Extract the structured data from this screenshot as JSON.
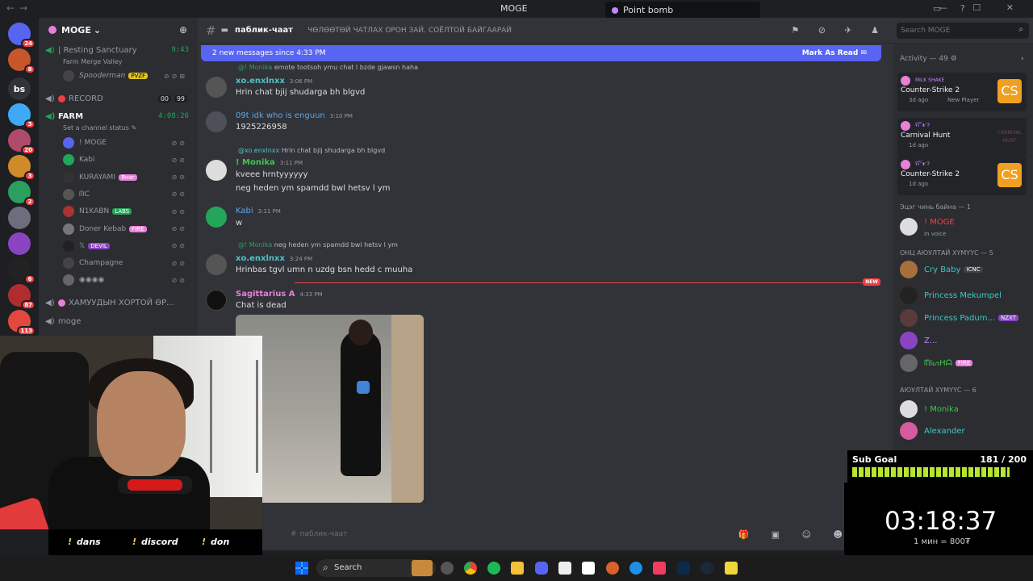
{
  "window": {
    "title": "MOGE",
    "overlay_title": "Point bomb"
  },
  "server": {
    "name": "MOGE",
    "add_member_icon": "add-member-icon"
  },
  "rail": {
    "servers": [
      {
        "label": "",
        "color": "#5865f2",
        "badge": "24"
      },
      {
        "label": "",
        "color": "#c9562b",
        "badge": "8"
      },
      {
        "label": "bs",
        "color": "#313338",
        "badge": ""
      },
      {
        "label": "",
        "color": "#3fa9f5",
        "badge": "3"
      },
      {
        "label": "",
        "color": "#b04a6a",
        "badge": "20"
      },
      {
        "label": "",
        "color": "#d18a28",
        "badge": "3"
      },
      {
        "label": "",
        "color": "#2aa05e",
        "badge": "2"
      },
      {
        "label": "",
        "color": "#6d6d7d",
        "badge": ""
      },
      {
        "label": "",
        "color": "#8a44c2",
        "badge": ""
      },
      {
        "label": "",
        "color": "#222",
        "badge": "6"
      },
      {
        "label": "",
        "color": "#b12d2d",
        "badge": "87"
      },
      {
        "label": "",
        "color": "#e2483f",
        "badge": "113"
      }
    ]
  },
  "sidebar": {
    "channels": [
      {
        "name": "| Resting Sanctuary",
        "right": "9:43",
        "sub": "Farm Merge Valley"
      },
      {
        "name": "RECORD",
        "count_left": "00",
        "count_right": "99"
      },
      {
        "name": "FARM",
        "right": "4:08:26",
        "sub": "Set a channel status"
      },
      {
        "name": "ХАМУУДЫН ХОРТОЙ ӨР..."
      },
      {
        "name": "moge"
      }
    ],
    "resting_member": {
      "name": "Spooderman",
      "tag": "PVZF"
    },
    "farm_members": [
      {
        "name": "! MOGE",
        "tag": ""
      },
      {
        "name": "Kabi",
        "tag": ""
      },
      {
        "name": "KURAYAMI",
        "tag": "Янаг"
      },
      {
        "name": "ᗰᑕ",
        "tag": ""
      },
      {
        "name": "N1KABN",
        "tag": "LABS"
      },
      {
        "name": "Doner Kebab",
        "tag": "FIRE"
      },
      {
        "name": "𝕏",
        "tag": "DEVIL"
      },
      {
        "name": "Champagne",
        "tag": ""
      },
      {
        "name": "◉◉◉◉",
        "tag": ""
      }
    ]
  },
  "header": {
    "channel_name": "паблик-чаат",
    "topic": "ЧӨЛӨӨТӨЙ ЧАТЛАХ ОРОН ЗАЙ. СОЁЛТОЙ БАЙГААРАЙ",
    "search_placeholder": "Search MOGE"
  },
  "newbar": {
    "text": "2 new messages since 4:33 PM",
    "mark_read": "Mark As Read"
  },
  "messages": [
    {
      "reply_name": "@! Monika",
      "reply_text": "emote tootsoh ymu chat l bzde gjawsn haha",
      "user": "xo.enxlnxx",
      "color": "#4fc3c9",
      "time": "3:06 PM",
      "text": "Hrin chat bjij shudarga bh blgvd"
    },
    {
      "user": "09t idk who is enguun",
      "color": "#5aa7e8",
      "time": "3:10 PM",
      "text": "1925226958"
    },
    {
      "reply_name": "@xo.enxlnxx",
      "reply_text": "Hrin chat bjij shudarga bh blgvd",
      "user": "! Monika",
      "color": "#3ec74f",
      "time": "3:11 PM",
      "text": "kveee hrntyyyyyy",
      "text2": "neg heden ym spamdd bwl hetsv l ym"
    },
    {
      "user": "Kabi",
      "color": "#5aa7e8",
      "time": "3:11 PM",
      "text": "w"
    },
    {
      "reply_name": "@! Monika",
      "reply_text": "neg heden ym spamdd bwl hetsv l ym",
      "user": "xo.enxlnxx",
      "color": "#4fc3c9",
      "time": "3:24 PM",
      "text": "Hrinbas tgvl umn n uzdg bsn hedd c muuha"
    },
    {
      "user": "Sagittarius A",
      "color": "#e87fd8",
      "time": "4:33 PM",
      "text": "Chat is dead"
    }
  ],
  "new_label": "NEW",
  "input": {
    "placeholder": "паблик-чаат"
  },
  "activity": {
    "title": "Activity — 49",
    "cards": [
      {
        "who": "MILK SHAKE",
        "game": "Counter-Strike 2",
        "ago": "3d ago",
        "extra": "New Player",
        "icon": "CS"
      },
      {
        "who": "ʢʕ͡ᵔᴥᵔʔ",
        "game": "Carnival Hunt",
        "ago": "1d ago",
        "extra": "",
        "icon": "CARNIVAL HUNT"
      },
      {
        "who": "ʢʕ͡ᵔᴥᵔʔ",
        "game": "Counter-Strike 2",
        "ago": "1d ago",
        "extra": "",
        "icon": "CS"
      }
    ]
  },
  "groups": [
    {
      "title": "Эцэг чинь байна — 1",
      "members": [
        {
          "name": "! MOGE",
          "color": "#f23f43",
          "status": "In voice"
        }
      ]
    },
    {
      "title": "ОНЦ АЮУЛТАЙ ХҮМҮҮС — 5",
      "members": [
        {
          "name": "Cry Baby",
          "color": "#3ec7c7",
          "tag": "ICNC"
        },
        {
          "name": "Princess Mekumpel",
          "color": "#3ec7c7",
          "tag": ""
        },
        {
          "name": "Princess Padum...",
          "color": "#3ec7c7",
          "tag": "NZXT"
        },
        {
          "name": "Z...",
          "color": "#c586ff",
          "tag": ""
        },
        {
          "name": "ᗰIᔕHᗩ",
          "color": "#3ec74f",
          "tag": "FIRE"
        }
      ]
    },
    {
      "title": "АЮУЛТАЙ ХҮМҮҮС — 6",
      "members": [
        {
          "name": "! Monika",
          "color": "#3ec74f",
          "tag": ""
        },
        {
          "name": "Alexander",
          "color": "#3ec7c7",
          "tag": ""
        }
      ]
    }
  ],
  "stream": {
    "commands": [
      "dans",
      "discord",
      "don"
    ],
    "sub_goal_label": "Sub Goal",
    "sub_goal_value": "181 / 200",
    "sub_goal_progress": 0.905,
    "timer": "03:18:37",
    "rate": "1 мин = 800₮"
  },
  "taskbar": {
    "search": "Search"
  }
}
